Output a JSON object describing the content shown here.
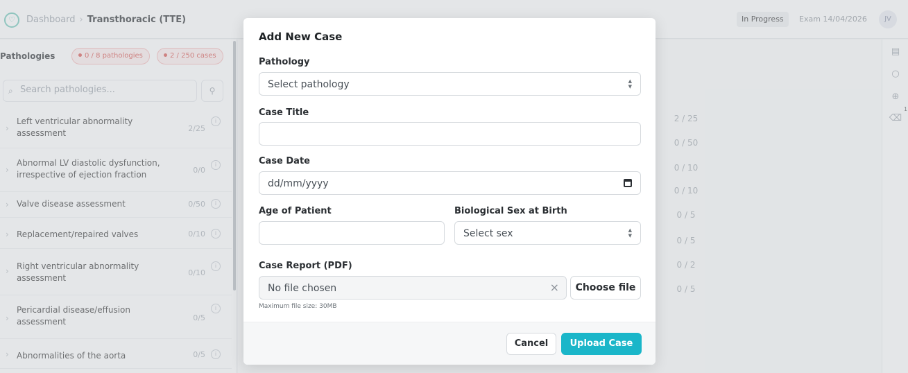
{
  "header": {
    "breadcrumb": {
      "parent": "Dashboard",
      "current": "Transthoracic (TTE)"
    },
    "status": "In Progress",
    "exam_date": "Exam 14/04/2026",
    "avatar_initials": "JV"
  },
  "sidebar": {
    "title": "Pathologies",
    "pathologies_pill": "0 / 8 pathologies",
    "cases_pill": "2 / 250 cases",
    "search_placeholder": "Search pathologies...",
    "items": [
      {
        "label": "Left ventricular abnormality assessment",
        "count": "2/25"
      },
      {
        "label": "Abnormal LV diastolic dysfunction, irrespective of ejection fraction",
        "count": "0/0"
      },
      {
        "label": "Valve disease assessment",
        "count": "0/50"
      },
      {
        "label": "Replacement/repaired valves",
        "count": "0/10"
      },
      {
        "label": "Right ventricular abnormality assessment",
        "count": "0/10"
      },
      {
        "label": "Pericardial disease/effusion assessment",
        "count": "0/5"
      },
      {
        "label": "Abnormalities of the aorta",
        "count": "0/5"
      }
    ]
  },
  "main": {
    "counts": [
      "2 / 25",
      "0 / 50",
      "0 / 10",
      "0 / 10",
      "0 / 5",
      "0 / 5",
      "0 / 2",
      "0 / 5"
    ]
  },
  "rail": {
    "trash_count": "1"
  },
  "modal": {
    "title": "Add New Case",
    "pathology_label": "Pathology",
    "pathology_value": "Select pathology",
    "case_title_label": "Case Title",
    "case_title_value": "",
    "case_date_label": "Case Date",
    "case_date_placeholder": "dd/mm/yyyy",
    "age_label": "Age of Patient",
    "age_value": "",
    "sex_label": "Biological Sex at Birth",
    "sex_value": "Select sex",
    "report_label": "Case Report (PDF)",
    "file_status": "No file chosen",
    "choose_file_label": "Choose file",
    "max_size_note": "Maximum file size: 30MB",
    "cancel_label": "Cancel",
    "upload_label": "Upload Case"
  }
}
